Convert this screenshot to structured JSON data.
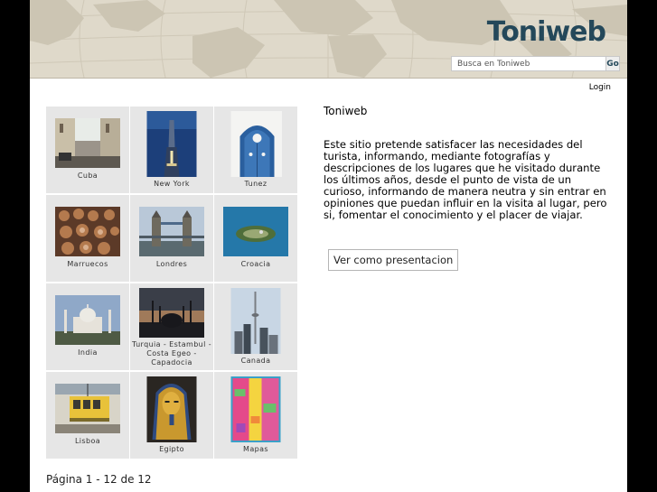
{
  "header": {
    "brand": "Toniweb",
    "search_placeholder": "Busca en Toniweb",
    "search_button": "Go"
  },
  "nav": {
    "login": "Login"
  },
  "gallery": [
    {
      "caption": "Cuba",
      "icon": "street-photo-icon"
    },
    {
      "caption": "New York",
      "icon": "skyscraper-photo-icon"
    },
    {
      "caption": "Tunez",
      "icon": "blue-door-photo-icon"
    },
    {
      "caption": "Marruecos",
      "icon": "dye-pits-photo-icon"
    },
    {
      "caption": "Londres",
      "icon": "tower-bridge-photo-icon"
    },
    {
      "caption": "Croacia",
      "icon": "island-photo-icon"
    },
    {
      "caption": "India",
      "icon": "taj-mahal-photo-icon"
    },
    {
      "caption": "Turquia - Estambul - Costa Egeo - Capadocia",
      "icon": "mosque-sunset-photo-icon"
    },
    {
      "caption": "Canada",
      "icon": "cn-tower-photo-icon"
    },
    {
      "caption": "Lisboa",
      "icon": "tram-photo-icon"
    },
    {
      "caption": "Egipto",
      "icon": "pharaoh-mask-photo-icon"
    },
    {
      "caption": "Mapas",
      "icon": "map-photo-icon"
    }
  ],
  "pager": "Página 1 - 12 de 12",
  "content": {
    "site_name": "Toniweb",
    "intro": "Este sitio pretende satisfacer las necesidades del turista, informando, mediante fotografías y descripciones de los lugares que he visitado durante los últimos años, desde el punto de vista de un curioso, informando de manera neutra y sin entrar en opiniones que puedan influir en la visita al lugar, pero si, fomentar el conocimiento y el placer de viajar.",
    "slideshow_button": "Ver como presentacion"
  },
  "colors": {
    "brand": "#24485a",
    "cell_bg": "#e6e6e6",
    "header_bg": "#dcd6c6"
  }
}
